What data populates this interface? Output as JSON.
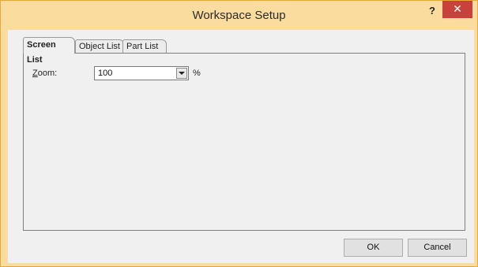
{
  "window": {
    "title": "Workspace Setup",
    "help_label": "?",
    "close_label": "✕"
  },
  "tabs": [
    {
      "label": "Screen List",
      "active": true
    },
    {
      "label": "Object List",
      "active": false
    },
    {
      "label": "Part List",
      "active": false
    }
  ],
  "zoom": {
    "label_prefix": "Z",
    "label_rest": "oom:",
    "value": "100",
    "unit": "%"
  },
  "buttons": {
    "ok_label": "OK",
    "cancel_label": "Cancel"
  }
}
